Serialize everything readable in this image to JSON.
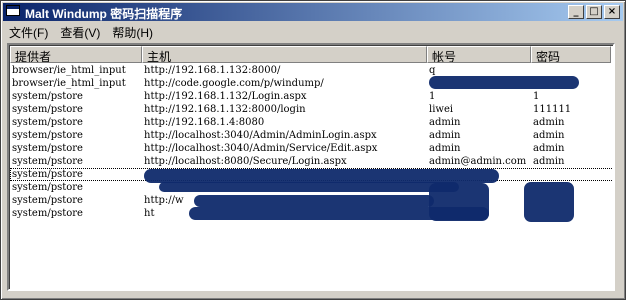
{
  "window": {
    "title": "Malt Windump 密码扫描程序",
    "controls": [
      "_",
      "□",
      "×"
    ]
  },
  "menu": [
    {
      "label": "文件(F)"
    },
    {
      "label": "查看(V)"
    },
    {
      "label": "帮助(H)"
    }
  ],
  "table": {
    "columns": [
      "提供者",
      "主机",
      "帐号",
      "密码"
    ],
    "rows": [
      [
        "browser/ie_html_input",
        "http://192.168.1.132:8000/",
        "q",
        ""
      ],
      [
        "browser/ie_html_input",
        "http://code.google.com/p/windump/",
        "",
        ""
      ],
      [
        "system/pstore",
        "http://192.168.1.132/Login.aspx",
        "1",
        "1"
      ],
      [
        "system/pstore",
        "http://192.168.1.132:8000/login",
        "liwei",
        "111111"
      ],
      [
        "system/pstore",
        "http://192.168.1.4:8080",
        "admin",
        "admin"
      ],
      [
        "system/pstore",
        "http://localhost:3040/Admin/AdminLogin.aspx",
        "admin",
        "admin"
      ],
      [
        "system/pstore",
        "http://localhost:3040/Admin/Service/Edit.aspx",
        "admin",
        "admin"
      ],
      [
        "system/pstore",
        "http://localhost:8080/Secure/Login.aspx",
        "admin@admin.com",
        "admin"
      ],
      [
        "system/pstore",
        "",
        "",
        ""
      ],
      [
        "system/pstore",
        "",
        "",
        ""
      ],
      [
        "system/pstore",
        "http://w",
        "",
        ""
      ],
      [
        "system/pstore",
        "ht",
        "",
        ""
      ]
    ]
  }
}
